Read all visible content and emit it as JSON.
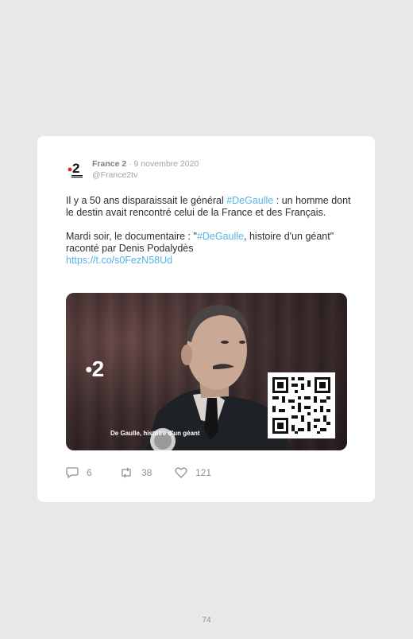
{
  "tweet": {
    "author_name": "France 2",
    "separator": " · ",
    "date": "9 novembre 2020",
    "handle": "@France2tv",
    "avatar_label": "2",
    "paragraph1": {
      "part1": "Il y a 50 ans disparaissait le général ",
      "hashtag": "#DeGaulle",
      "part2": " : un homme dont le destin avait rencontré celui de la France et des Français."
    },
    "paragraph2": {
      "part1": "Mardi soir, le documentaire : \"",
      "hashtag": "#DeGaulle",
      "part2": ", histoire d'un géant\" raconté par Denis Podalydès",
      "link": "https://t.co/s0FezN58Ud"
    },
    "media": {
      "channel_logo": "2",
      "caption": "De Gaulle, histoire d'un géant"
    },
    "actions": {
      "replies": "6",
      "retweets": "38",
      "likes": "121"
    }
  },
  "page_number": "74",
  "colors": {
    "link": "#56b3e6",
    "background": "#e7e8ea",
    "card": "#ffffff"
  }
}
